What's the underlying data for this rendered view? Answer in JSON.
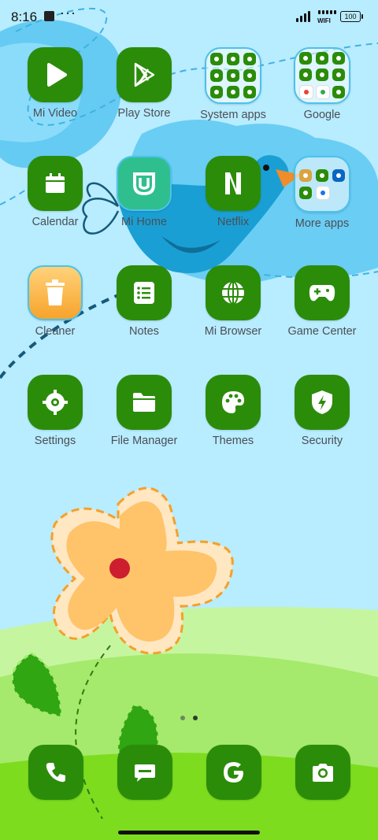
{
  "status_bar": {
    "time": "8:16",
    "overflow": "···",
    "wifi": "WIFI",
    "battery": "100"
  },
  "apps": [
    {
      "label": "Mi Video",
      "icon": "play-icon"
    },
    {
      "label": "Play Store",
      "icon": "play-store-icon"
    },
    {
      "label": "System apps",
      "icon": "folder-icon"
    },
    {
      "label": "Google",
      "icon": "folder-icon"
    },
    {
      "label": "Calendar",
      "icon": "calendar-icon"
    },
    {
      "label": "Mi Home",
      "icon": "mi-home-icon"
    },
    {
      "label": "Netflix",
      "icon": "netflix-icon"
    },
    {
      "label": "More apps",
      "icon": "folder-icon"
    },
    {
      "label": "Cleaner",
      "icon": "trash-icon"
    },
    {
      "label": "Notes",
      "icon": "notes-icon"
    },
    {
      "label": "Mi Browser",
      "icon": "globe-icon"
    },
    {
      "label": "Game Center",
      "icon": "gamepad-icon"
    },
    {
      "label": "Settings",
      "icon": "gear-icon"
    },
    {
      "label": "File Manager",
      "icon": "folder-file-icon"
    },
    {
      "label": "Themes",
      "icon": "palette-icon"
    },
    {
      "label": "Security",
      "icon": "shield-icon"
    }
  ],
  "dock": [
    {
      "name": "phone",
      "icon": "phone-icon"
    },
    {
      "name": "messages",
      "icon": "message-icon"
    },
    {
      "name": "google",
      "icon": "google-g-icon"
    },
    {
      "name": "camera",
      "icon": "camera-icon"
    }
  ],
  "page_indicator": {
    "pages": 2,
    "current": 2
  },
  "colors": {
    "icon_tile": "#2b8c0a",
    "sky": "#b8ecff",
    "grass": "#8fe04a",
    "flower": "#ffc36a"
  }
}
